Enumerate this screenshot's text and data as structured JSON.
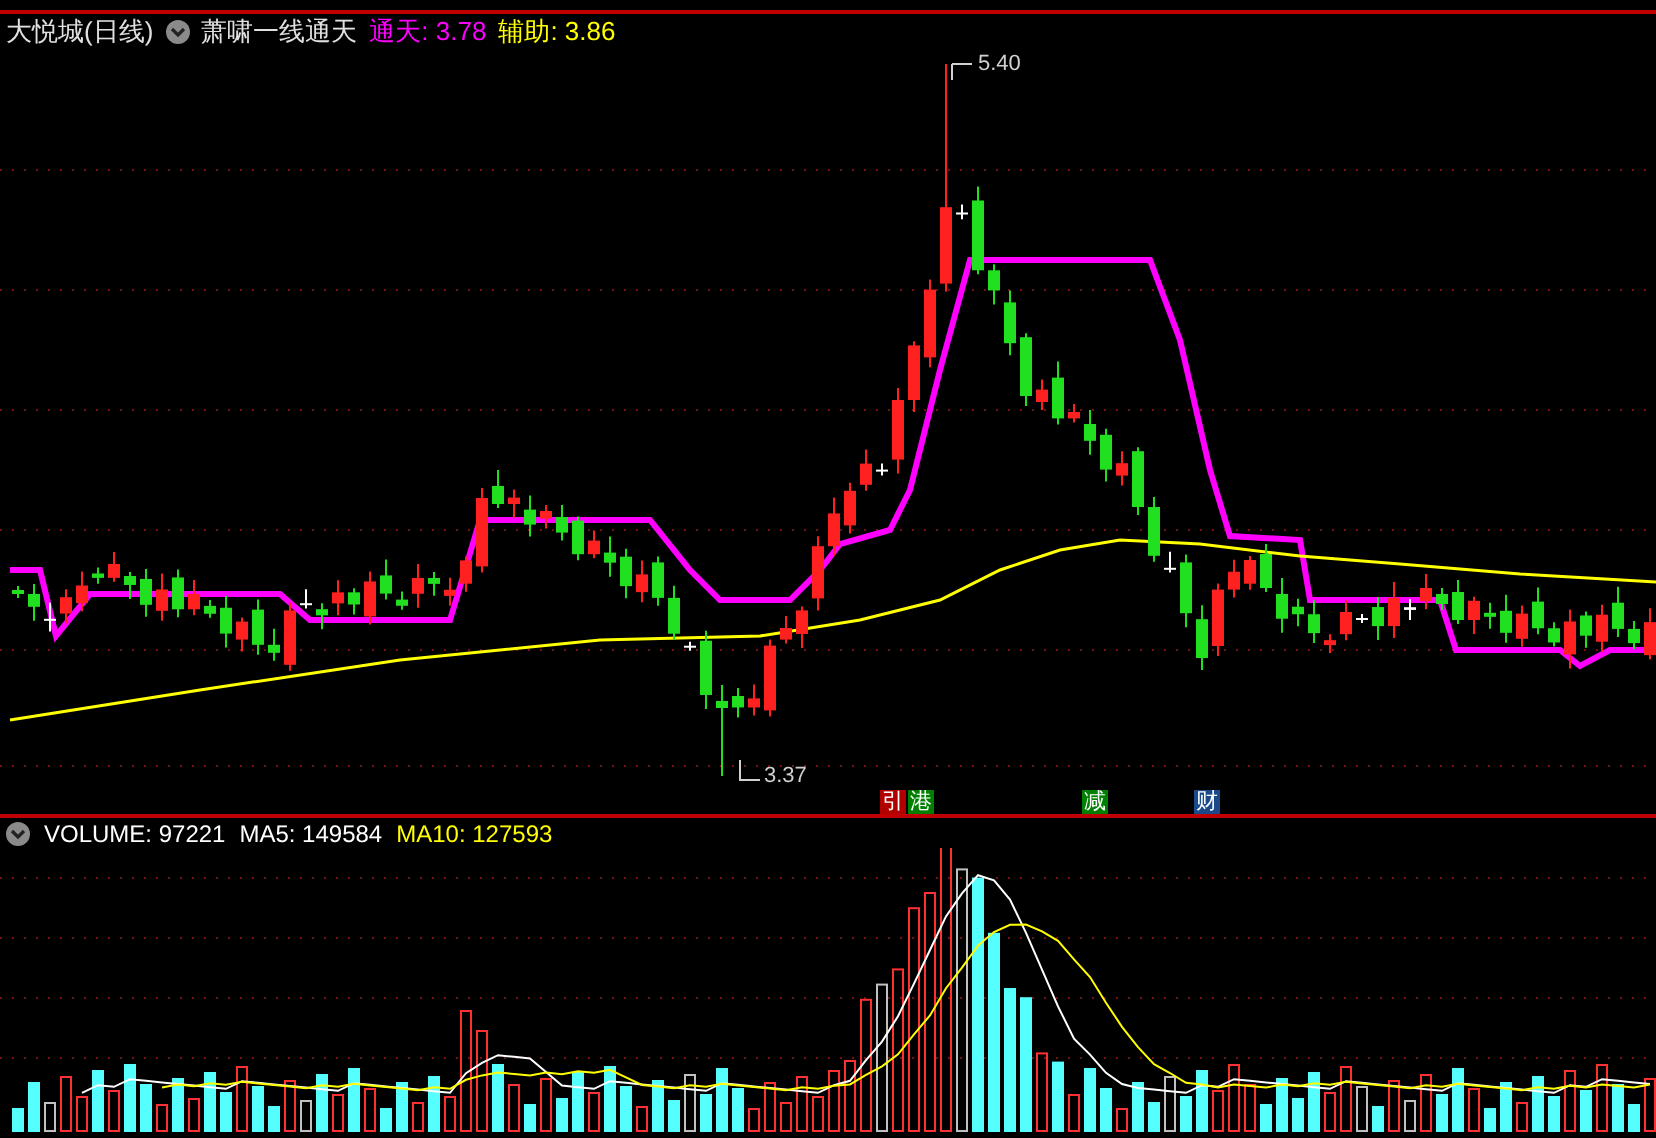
{
  "price_panel": {
    "title": "大悦城(日线)",
    "indicator": "萧啸一线通天",
    "legend": [
      {
        "label": "通天: 3.78",
        "color": "#ff00ff"
      },
      {
        "label": "辅助: 3.86",
        "color": "#ffff00"
      }
    ],
    "high_label": "5.40",
    "low_label": "3.37",
    "markers": [
      {
        "text": "引",
        "color": "#b00000"
      },
      {
        "text": "港",
        "color": "#008000"
      },
      {
        "text": "减",
        "color": "#008000"
      },
      {
        "text": "财",
        "color": "#1a4a8a"
      }
    ]
  },
  "volume_panel": {
    "legend": [
      {
        "label": "VOLUME: 97221",
        "color": "#ffffff"
      },
      {
        "label": "MA5: 149584",
        "color": "#ffffff"
      },
      {
        "label": "MA10: 127593",
        "color": "#ffff00"
      }
    ]
  }
}
